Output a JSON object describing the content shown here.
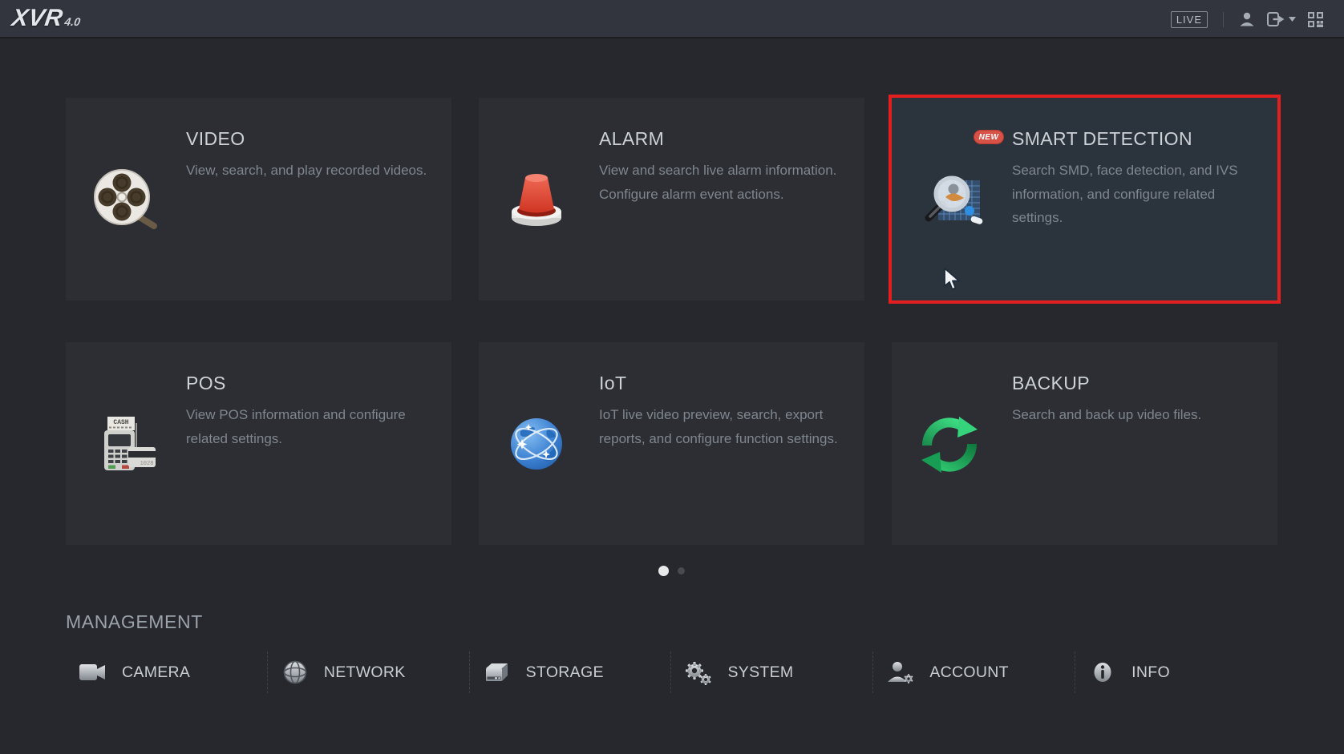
{
  "topbar": {
    "logo_text": "XVR",
    "logo_version": "4.0",
    "live_label": "LIVE"
  },
  "tiles": [
    {
      "id": "video",
      "title": "VIDEO",
      "description": "View, search, and play recorded videos.",
      "icon": "film-reel-icon"
    },
    {
      "id": "alarm",
      "title": "ALARM",
      "description": "View and search live alarm information. Configure alarm event actions.",
      "icon": "siren-icon"
    },
    {
      "id": "smart-detection",
      "title": "SMART DETECTION",
      "badge": "NEW",
      "selected": true,
      "description": "Search SMD, face detection, and IVS information, and configure related settings.",
      "icon": "smart-detection-magnifier-icon"
    },
    {
      "id": "pos",
      "title": "POS",
      "description": "View POS information and configure related settings.",
      "icon": "pos-terminal-icon"
    },
    {
      "id": "iot",
      "title": "IoT",
      "description": "IoT live video preview, search, export reports, and configure function settings.",
      "icon": "globe-network-icon"
    },
    {
      "id": "backup",
      "title": "BACKUP",
      "description": "Search and back up video files.",
      "icon": "sync-arrows-icon"
    }
  ],
  "pagination": {
    "dots": 2,
    "active_index": 0
  },
  "management": {
    "title": "MANAGEMENT",
    "items": [
      {
        "label": "CAMERA",
        "icon": "video-camera-icon"
      },
      {
        "label": "NETWORK",
        "icon": "network-globe-icon"
      },
      {
        "label": "STORAGE",
        "icon": "storage-drive-icon"
      },
      {
        "label": "SYSTEM",
        "icon": "gears-icon"
      },
      {
        "label": "ACCOUNT",
        "icon": "user-gear-icon"
      },
      {
        "label": "INFO",
        "icon": "info-icon"
      }
    ]
  },
  "icon_art_text": {
    "pos_paper": "CASH",
    "pos_card": "1028"
  },
  "colors": {
    "page_bg": "#26282d",
    "topbar_bg": "#32353d",
    "tile_bg": "#2c2e34",
    "selected_tile_bg": "#2b333c",
    "selection_border": "#e41f1f",
    "badge_bg": "#d65146",
    "alarm_red": "#d9402c",
    "iot_blue": "#3e82d2",
    "backup_green": "#2bbd68",
    "title_text": "#cdd2d7",
    "desc_text": "#7f868e"
  }
}
